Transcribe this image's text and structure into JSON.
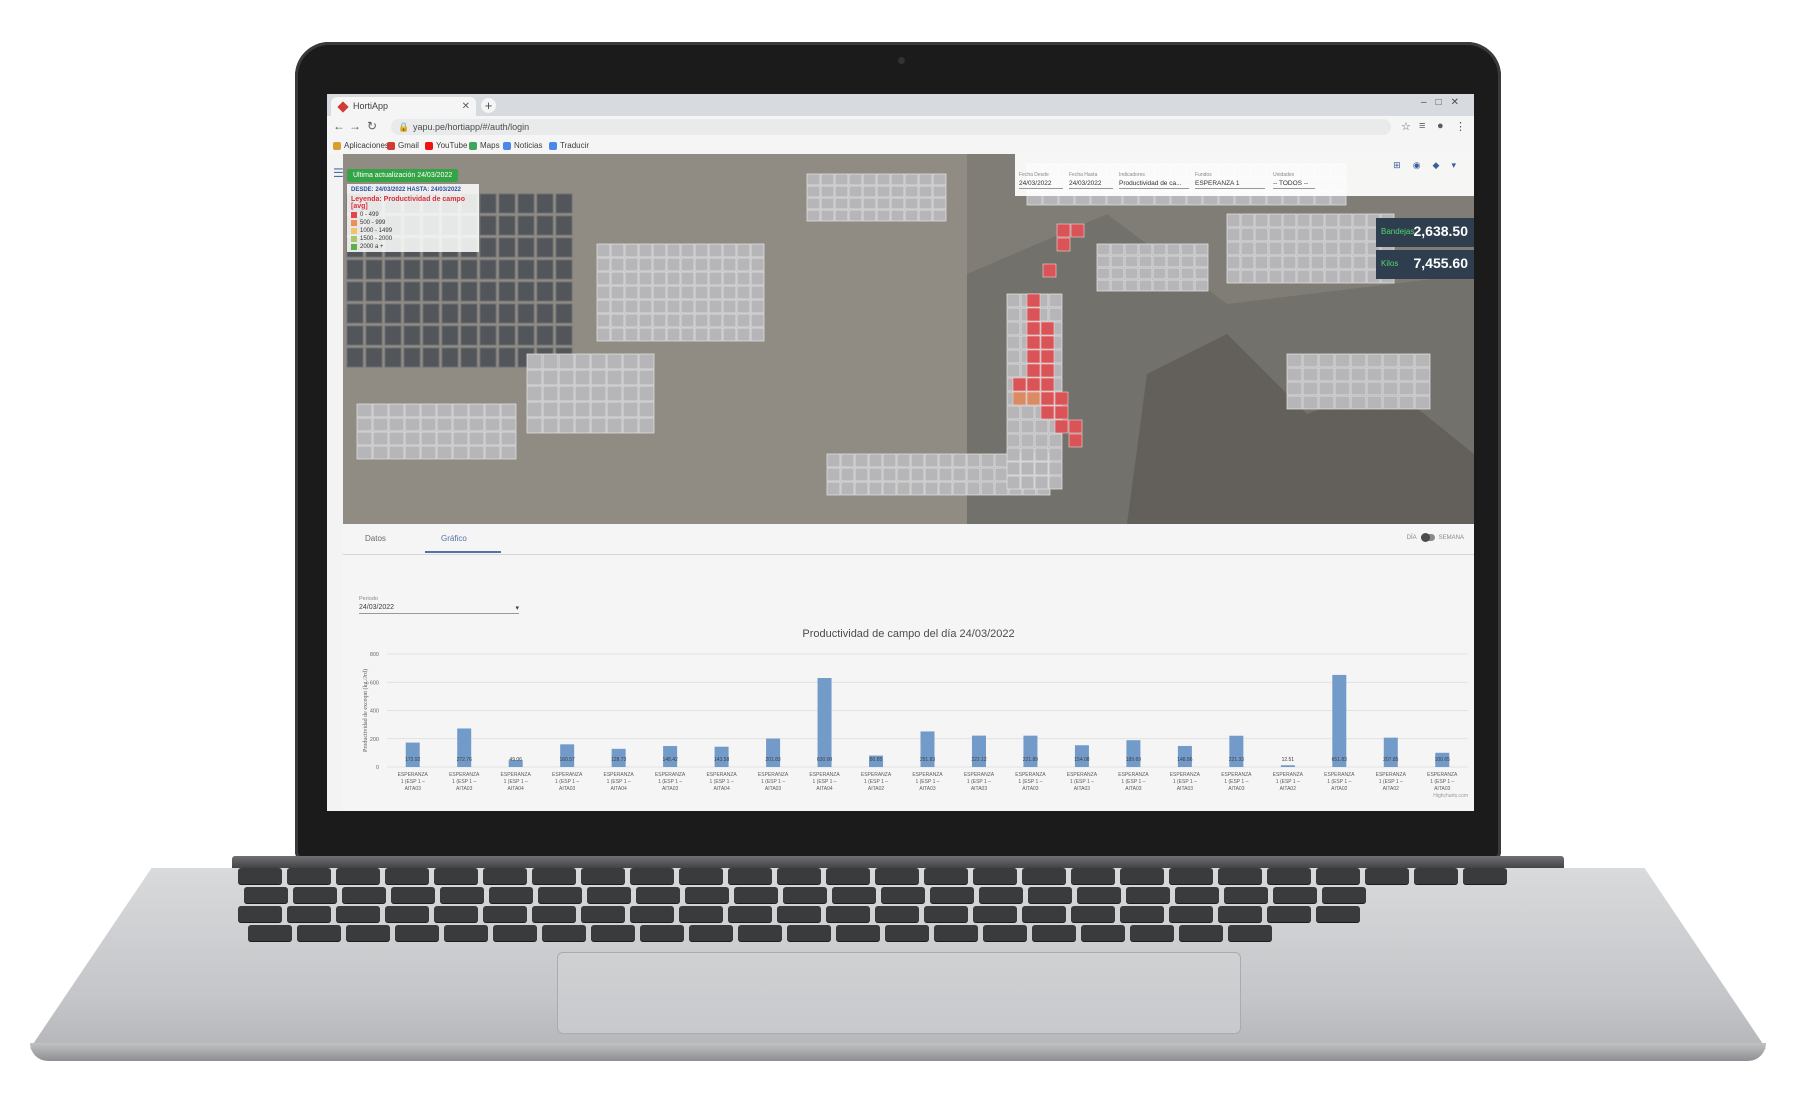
{
  "browser": {
    "tab_title": "HortiApp",
    "url": "yapu.pe/hortiapp/#/auth/login",
    "bookmarks": [
      {
        "label": "Aplicaciones",
        "icon": "apps-grid-icon",
        "color": "#e0a020"
      },
      {
        "label": "Gmail",
        "icon": "gmail-icon",
        "color": "#d93025"
      },
      {
        "label": "YouTube",
        "icon": "youtube-icon",
        "color": "#ff0000"
      },
      {
        "label": "Maps",
        "icon": "maps-icon",
        "color": "#34a853"
      },
      {
        "label": "Noticias",
        "icon": "news-icon",
        "color": "#4285f4"
      },
      {
        "label": "Traducir",
        "icon": "translate-icon",
        "color": "#4285f4"
      }
    ]
  },
  "map_panel": {
    "update_badge": "Ultima actualización 24/03/2022",
    "legend": {
      "range": "DESDE: 24/03/2022 HASTA: 24/03/2022",
      "title": "Leyenda: Productividad de campo [avg]",
      "items": [
        {
          "label": "0 - 499",
          "color": "#e8454b"
        },
        {
          "label": "500 - 999",
          "color": "#f08d5a"
        },
        {
          "label": "1000 - 1499",
          "color": "#f2c36b"
        },
        {
          "label": "1500 - 2000",
          "color": "#a8c66c"
        },
        {
          "label": "2000 a +",
          "color": "#5fae4a"
        }
      ]
    },
    "filters": [
      {
        "label": "Fecha Desde",
        "value": "24/03/2022"
      },
      {
        "label": "Fecha Hasta",
        "value": "24/03/2022"
      },
      {
        "label": "Indicadores",
        "value": "Productividad de ca..."
      },
      {
        "label": "Fundos",
        "value": "ESPERANZA 1"
      },
      {
        "label": "Unidades",
        "value": "-- TODOS --"
      }
    ],
    "kpis": [
      {
        "label": "Bandejas",
        "value": "2,638.50"
      },
      {
        "label": "Kilos",
        "value": "7,455.60"
      }
    ]
  },
  "bottom_panel": {
    "tabs": [
      "Datos",
      "Gráfico"
    ],
    "active_tab": "Gráfico",
    "toggle_left": "DÍA",
    "toggle_right": "SEMANA",
    "period_label": "Periodo",
    "period_value": "24/03/2022",
    "credit": "Highcharts.com"
  },
  "chart_data": {
    "type": "bar",
    "title": "Productividad de campo del día 24/03/2022",
    "ylabel": "Productividad de exceqnt (kg./Jrd)",
    "ylim": [
      0,
      800
    ],
    "yticks": [
      0,
      200,
      400,
      600,
      800
    ],
    "categories": [
      [
        "ESPERANZA",
        "1 (ESP 1 –",
        "AITA03"
      ],
      [
        "ESPERANZA",
        "1 (ESP 1 –",
        "AITA03"
      ],
      [
        "ESPERANZA",
        "1 (ESP 1 –",
        "AITA04"
      ],
      [
        "ESPERANZA",
        "1 (ESP 1 –",
        "AITA03"
      ],
      [
        "ESPERANZA",
        "1 (ESP 1 –",
        "AITA04"
      ],
      [
        "ESPERANZA",
        "1 (ESP 1 –",
        "AITA03"
      ],
      [
        "ESPERANZA",
        "1 (ESP 1 –",
        "AITA04"
      ],
      [
        "ESPERANZA",
        "1 (ESP 1 –",
        "AITA03"
      ],
      [
        "ESPERANZA",
        "1 (ESP 1 –",
        "AITA04"
      ],
      [
        "ESPERANZA",
        "1 (ESP 1 –",
        "AITA02"
      ],
      [
        "ESPERANZA",
        "1 (ESP 1 –",
        "AITA03"
      ],
      [
        "ESPERANZA",
        "1 (ESP 1 –",
        "AITA03"
      ],
      [
        "ESPERANZA",
        "1 (ESP 1 –",
        "AITA03"
      ],
      [
        "ESPERANZA",
        "1 (ESP 1 –",
        "AITA03"
      ],
      [
        "ESPERANZA",
        "1 (ESP 1 –",
        "AITA03"
      ],
      [
        "ESPERANZA",
        "1 (ESP 1 –",
        "AITA03"
      ],
      [
        "ESPERANZA",
        "1 (ESP 1 –",
        "AITA03"
      ],
      [
        "ESPERANZA",
        "1 (ESP 1 –",
        "AITA02"
      ],
      [
        "ESPERANZA",
        "1 (ESP 1 –",
        "AITA02"
      ],
      [
        "ESPERANZA",
        "1 (ESP 1 –",
        "AITA02"
      ],
      [
        "ESPERANZA",
        "1 (ESP 1 –",
        "AITA03"
      ]
    ],
    "values": [
      172.92,
      272.76,
      49.06,
      160.57,
      128.73,
      148.42,
      143.58,
      201.83,
      630.0,
      80.85,
      251.83,
      222.12,
      221.89,
      154.08,
      189.69,
      148.86,
      221.33,
      12.51,
      651.83,
      207.85,
      100.65
    ],
    "bar_color": "#6e9bd0",
    "grid": true,
    "legend": "none"
  }
}
